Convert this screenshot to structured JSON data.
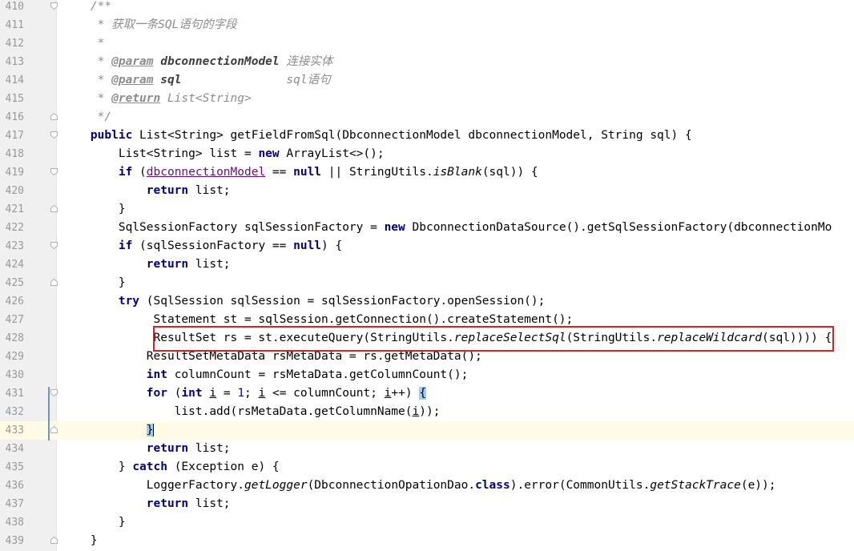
{
  "editor": {
    "current_line": 433,
    "lines": [
      {
        "n": "410",
        "fold": "start",
        "segs": [
          {
            "t": "    /**",
            "c": "c"
          }
        ]
      },
      {
        "n": "411",
        "fold": "",
        "segs": [
          {
            "t": "     * 获取一条SQL语句的字段",
            "c": "c"
          }
        ]
      },
      {
        "n": "412",
        "fold": "",
        "segs": [
          {
            "t": "     *",
            "c": "c"
          }
        ]
      },
      {
        "n": "413",
        "fold": "",
        "segs": [
          {
            "t": "     * ",
            "c": "c"
          },
          {
            "t": "@param",
            "c": "tag"
          },
          {
            "t": " ",
            "c": "c"
          },
          {
            "t": "dbconnectionModel",
            "c": "pname"
          },
          {
            "t": " 连接实体",
            "c": "c"
          }
        ]
      },
      {
        "n": "414",
        "fold": "",
        "segs": [
          {
            "t": "     * ",
            "c": "c"
          },
          {
            "t": "@param",
            "c": "tag"
          },
          {
            "t": " ",
            "c": "c"
          },
          {
            "t": "sql",
            "c": "pname"
          },
          {
            "t": "               sql语句",
            "c": "c"
          }
        ]
      },
      {
        "n": "415",
        "fold": "",
        "segs": [
          {
            "t": "     * ",
            "c": "c"
          },
          {
            "t": "@return",
            "c": "tag"
          },
          {
            "t": " List<String>",
            "c": "c"
          }
        ]
      },
      {
        "n": "416",
        "fold": "end",
        "segs": [
          {
            "t": "     */",
            "c": "c"
          }
        ]
      },
      {
        "n": "417",
        "fold": "start",
        "segs": [
          {
            "t": "    "
          },
          {
            "t": "public",
            "c": "k"
          },
          {
            "t": " List<String> getFieldFromSql(DbconnectionModel dbconnectionModel, String sql) {"
          }
        ]
      },
      {
        "n": "418",
        "fold": "",
        "segs": [
          {
            "t": "        List<String> list = "
          },
          {
            "t": "new",
            "c": "k"
          },
          {
            "t": " ArrayList<>();"
          }
        ]
      },
      {
        "n": "419",
        "fold": "start",
        "segs": [
          {
            "t": "        "
          },
          {
            "t": "if",
            "c": "k"
          },
          {
            "t": " ("
          },
          {
            "t": "dbconnectionModel",
            "c": "f"
          },
          {
            "t": " == "
          },
          {
            "t": "null",
            "c": "k"
          },
          {
            "t": " || StringUtils."
          },
          {
            "t": "isBlank",
            "c": "it"
          },
          {
            "t": "(sql)) {"
          }
        ]
      },
      {
        "n": "420",
        "fold": "",
        "segs": [
          {
            "t": "            "
          },
          {
            "t": "return",
            "c": "k"
          },
          {
            "t": " list;"
          }
        ]
      },
      {
        "n": "421",
        "fold": "end",
        "segs": [
          {
            "t": "        }"
          }
        ]
      },
      {
        "n": "422",
        "fold": "",
        "segs": [
          {
            "t": "        SqlSessionFactory sqlSessionFactory = "
          },
          {
            "t": "new",
            "c": "k"
          },
          {
            "t": " DbconnectionDataSource().getSqlSessionFactory(dbconnectionMo"
          }
        ]
      },
      {
        "n": "423",
        "fold": "start",
        "segs": [
          {
            "t": "        "
          },
          {
            "t": "if",
            "c": "k"
          },
          {
            "t": " (sqlSessionFactory == "
          },
          {
            "t": "null",
            "c": "k"
          },
          {
            "t": ") {"
          }
        ]
      },
      {
        "n": "424",
        "fold": "",
        "segs": [
          {
            "t": "            "
          },
          {
            "t": "return",
            "c": "k"
          },
          {
            "t": " list;"
          }
        ]
      },
      {
        "n": "425",
        "fold": "end",
        "segs": [
          {
            "t": "        }"
          }
        ]
      },
      {
        "n": "426",
        "fold": "",
        "segs": [
          {
            "t": "        "
          },
          {
            "t": "try",
            "c": "k"
          },
          {
            "t": " (SqlSession sqlSession = sqlSessionFactory.openSession();"
          }
        ]
      },
      {
        "n": "427",
        "fold": "",
        "segs": [
          {
            "t": "             Statement st = sqlSession.getConnection().createStatement();"
          }
        ]
      },
      {
        "n": "428",
        "fold": "",
        "segs": [
          {
            "t": "             ResultSet rs = st.executeQuery(StringUtils."
          },
          {
            "t": "replaceSelectSql",
            "c": "it"
          },
          {
            "t": "(StringUtils."
          },
          {
            "t": "replaceWildcard",
            "c": "it"
          },
          {
            "t": "(sql)))) {"
          }
        ]
      },
      {
        "n": "429",
        "fold": "",
        "segs": [
          {
            "t": "            ResultSetMetaData rsMetaData = rs.getMetaData();"
          }
        ]
      },
      {
        "n": "430",
        "fold": "",
        "segs": [
          {
            "t": "            "
          },
          {
            "t": "int",
            "c": "k"
          },
          {
            "t": " columnCount = rsMetaData.getColumnCount();"
          }
        ]
      },
      {
        "n": "431",
        "fold": "start",
        "segs": [
          {
            "t": "            "
          },
          {
            "t": "for",
            "c": "k"
          },
          {
            "t": " ("
          },
          {
            "t": "int",
            "c": "k"
          },
          {
            "t": " "
          },
          {
            "t": "i",
            "c": "u"
          },
          {
            "t": " = "
          },
          {
            "t": "1",
            "c": "num-lit"
          },
          {
            "t": "; "
          },
          {
            "t": "i",
            "c": "u"
          },
          {
            "t": " <= columnCount; "
          },
          {
            "t": "i",
            "c": "u"
          },
          {
            "t": "++) "
          },
          {
            "t": "{",
            "c": "brace"
          }
        ]
      },
      {
        "n": "432",
        "fold": "",
        "segs": [
          {
            "t": "                list.add(rsMetaData.getColumnName("
          },
          {
            "t": "i",
            "c": "u"
          },
          {
            "t": "));"
          }
        ]
      },
      {
        "n": "433",
        "fold": "end",
        "segs": [
          {
            "t": "            "
          },
          {
            "t": "}",
            "c": "brace"
          },
          {
            "t": "",
            "c": "caret"
          }
        ]
      },
      {
        "n": "434",
        "fold": "",
        "segs": [
          {
            "t": "            "
          },
          {
            "t": "return",
            "c": "k"
          },
          {
            "t": " list;"
          }
        ]
      },
      {
        "n": "435",
        "fold": "",
        "segs": [
          {
            "t": "        } "
          },
          {
            "t": "catch",
            "c": "k"
          },
          {
            "t": " (Exception e) {"
          }
        ]
      },
      {
        "n": "436",
        "fold": "",
        "segs": [
          {
            "t": "            LoggerFactory."
          },
          {
            "t": "getLogger",
            "c": "it"
          },
          {
            "t": "(DbconnectionOpationDao."
          },
          {
            "t": "class",
            "c": "k"
          },
          {
            "t": ").error(CommonUtils."
          },
          {
            "t": "getStackTrace",
            "c": "it"
          },
          {
            "t": "(e));"
          }
        ]
      },
      {
        "n": "437",
        "fold": "",
        "segs": [
          {
            "t": "            "
          },
          {
            "t": "return",
            "c": "k"
          },
          {
            "t": " list;"
          }
        ]
      },
      {
        "n": "438",
        "fold": "",
        "segs": [
          {
            "t": "        }"
          }
        ]
      },
      {
        "n": "439",
        "fold": "end",
        "segs": [
          {
            "t": "    }"
          }
        ]
      }
    ]
  },
  "highlight": {
    "color": "#e02020",
    "line": "428"
  },
  "colors": {
    "keyword": "#000080",
    "comment": "#8c8c8c",
    "field": "#660e7a",
    "number": "#0000ff",
    "gutter": "#f0f0f0",
    "current_line": "#fffbe6",
    "brace_match": "#99ccff"
  }
}
